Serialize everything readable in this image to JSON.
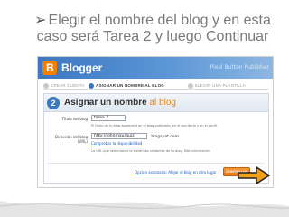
{
  "slide": {
    "bullet": "➢",
    "title": "Elegir el nombre del blog y en esta caso será Tarea 2 y luego Continuar"
  },
  "blogger": {
    "brand": "Blogger",
    "header_link": "Pixel Button Publisher",
    "steps": [
      {
        "num": "1",
        "label": "CREAR CUENTA"
      },
      {
        "num": "2",
        "label": "ASIGNAR UN NOMBRE AL BLOG"
      },
      {
        "num": "3",
        "label": "ELEGIR UNA PLANTILLA"
      }
    ],
    "panel": {
      "step_number": "2",
      "title_main": "Asignar un nombre",
      "title_accent": "al blog"
    },
    "form": {
      "title_label": "Título del blog",
      "title_value": "tarea 2",
      "title_hint": "El título de tu blog aparecerá en el blog publicado, en el escritorio y en el perfil.",
      "address_label": "Dirección del blog (URL)",
      "address_value": "http://johnmaurquiz",
      "address_domain": ".blogspot.com",
      "check_link": "Comprobar la disponibilidad",
      "address_hint": "La URL que selecciones la leerán los visitantes de tu blog. Más información",
      "footer_link": "Opción avanzada: Alojar el blog en otro lugar",
      "continue_label": "CONTINUAR"
    },
    "colors": {
      "header": "#3d77c2",
      "accent": "#e0861a",
      "button": "#e07414",
      "link": "#1a58b8"
    }
  }
}
